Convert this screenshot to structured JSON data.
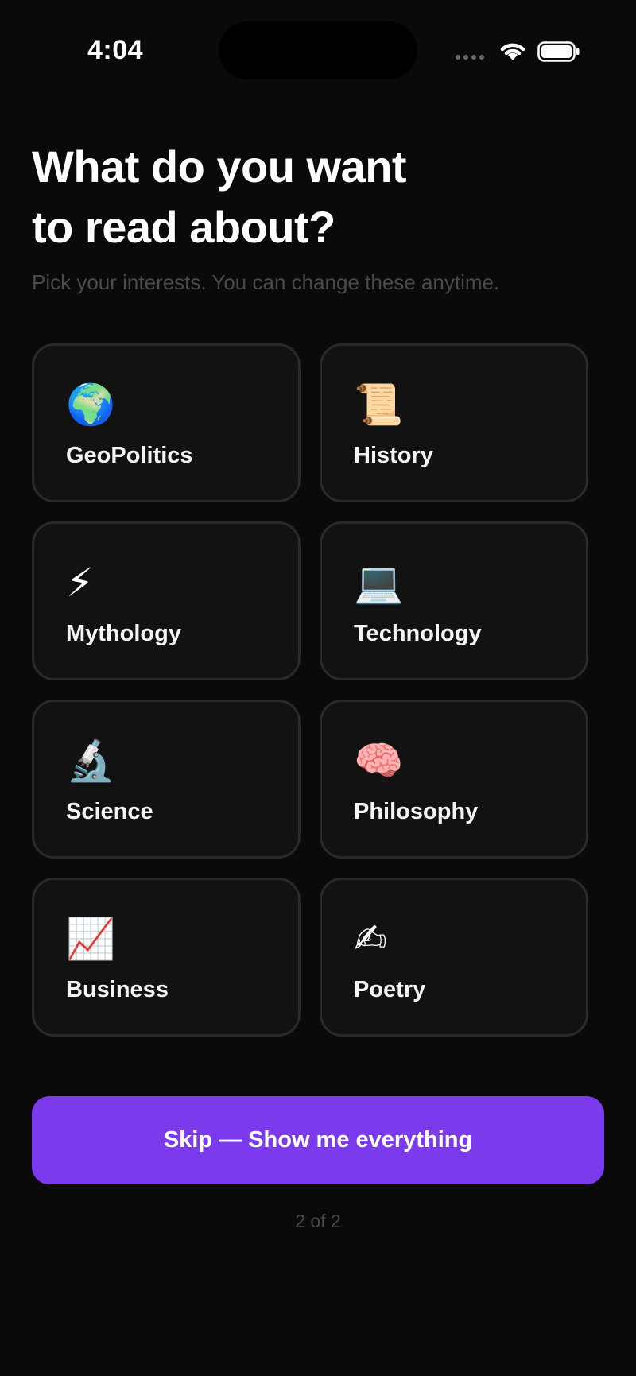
{
  "status_bar": {
    "time": "4:04"
  },
  "header": {
    "title_line1": "What do you want",
    "title_line2": "to read about?",
    "subtitle": "Pick your interests. You can change these anytime."
  },
  "interests": [
    {
      "label": "GeoPolitics",
      "emoji": "🌍",
      "icon": "globe-icon"
    },
    {
      "label": "History",
      "emoji": "📜",
      "icon": "scroll-icon"
    },
    {
      "label": "Mythology",
      "emoji": "⚡",
      "icon": "lightning-icon"
    },
    {
      "label": "Technology",
      "emoji": "💻",
      "icon": "laptop-icon"
    },
    {
      "label": "Science",
      "emoji": "🔬",
      "icon": "microscope-icon"
    },
    {
      "label": "Philosophy",
      "emoji": "🧠",
      "icon": "brain-icon"
    },
    {
      "label": "Business",
      "emoji": "📈",
      "icon": "chart-increasing-icon"
    },
    {
      "label": "Poetry",
      "emoji": "✍",
      "icon": "writing-hand-icon"
    }
  ],
  "skip_button": {
    "label": "Skip — Show me everything"
  },
  "pagination": {
    "label": "2 of 2"
  },
  "colors": {
    "background": "#0a0a0a",
    "card_background": "#121212",
    "card_border": "#2a2a2a",
    "accent": "#7c3aed",
    "muted_text": "#4a4a4a"
  }
}
